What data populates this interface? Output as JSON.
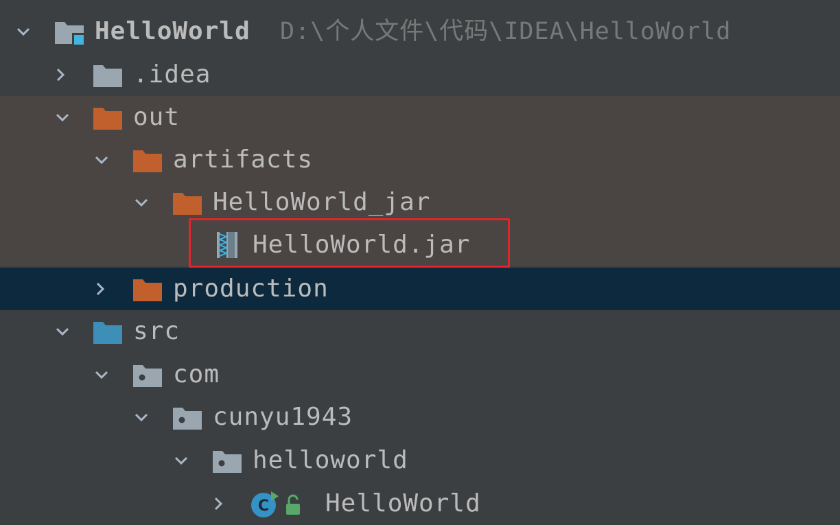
{
  "project": {
    "name": "HelloWorld",
    "path": "D:\\个人文件\\代码\\IDEA\\HelloWorld"
  },
  "nodes": {
    "idea": ".idea",
    "out": "out",
    "artifacts": "artifacts",
    "jar_folder": "HelloWorld_jar",
    "jar_file": "HelloWorld.jar",
    "production": "production",
    "src": "src",
    "com": "com",
    "cunyu": "cunyu1943",
    "helloworld_pkg": "helloworld",
    "helloworld_class": "HelloWorld"
  },
  "colors": {
    "background": "#3c3f41",
    "excluded_row": "#4a4442",
    "selected_row": "#0d293e",
    "orange_folder": "#c1602d",
    "blue_folder": "#3d8fb8",
    "gray_folder": "#9aa7b0",
    "highlight_border": "#e0252b"
  },
  "icons": {
    "project": "project-folder-icon",
    "folder": "folder-icon",
    "excluded_folder": "excluded-folder-icon",
    "source_folder": "source-folder-icon",
    "package": "package-icon",
    "jar": "jar-archive-icon",
    "class": "java-class-icon"
  }
}
